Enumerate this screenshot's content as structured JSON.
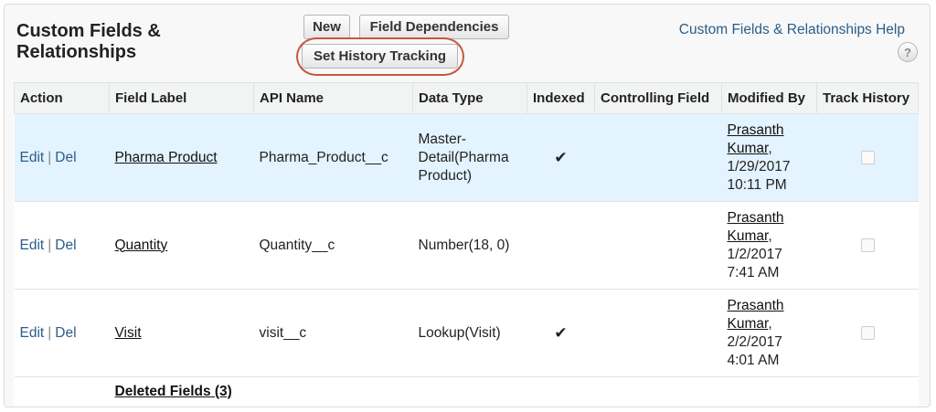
{
  "header": {
    "title": "Custom Fields & Relationships",
    "help_link": "Custom Fields & Relationships Help",
    "help_icon": "?"
  },
  "buttons": {
    "new": "New",
    "field_dependencies": "Field Dependencies",
    "set_history_tracking": "Set History Tracking"
  },
  "table": {
    "columns": [
      "Action",
      "Field Label",
      "API Name",
      "Data Type",
      "Indexed",
      "Controlling Field",
      "Modified By",
      "Track History"
    ],
    "rows": [
      {
        "edit": "Edit",
        "sep": "|",
        "del": "Del",
        "label": "Pharma Product",
        "api": "Pharma_Product__c",
        "type": "Master-Detail(Pharma Product)",
        "indexed": "✔",
        "controlling": "",
        "modified_name": "Prasanth Kumar",
        "modified_date": "1/29/2017 10:11 PM"
      },
      {
        "edit": "Edit",
        "sep": "|",
        "del": "Del",
        "label": "Quantity",
        "api": "Quantity__c",
        "type": "Number(18, 0)",
        "indexed": "",
        "controlling": "",
        "modified_name": "Prasanth Kumar",
        "modified_date": "1/2/2017 7:41 AM"
      },
      {
        "edit": "Edit",
        "sep": "|",
        "del": "Del",
        "label": "Visit",
        "api": "visit__c",
        "type": "Lookup(Visit)",
        "indexed": "✔",
        "controlling": "",
        "modified_name": "Prasanth Kumar",
        "modified_date": "2/2/2017 4:01 AM"
      }
    ],
    "deleted_fields": "Deleted Fields (3)"
  },
  "colors": {
    "link": "#2a5d8a",
    "row_highlight": "#e3f3ff",
    "annotation_ring": "#c9573e"
  }
}
